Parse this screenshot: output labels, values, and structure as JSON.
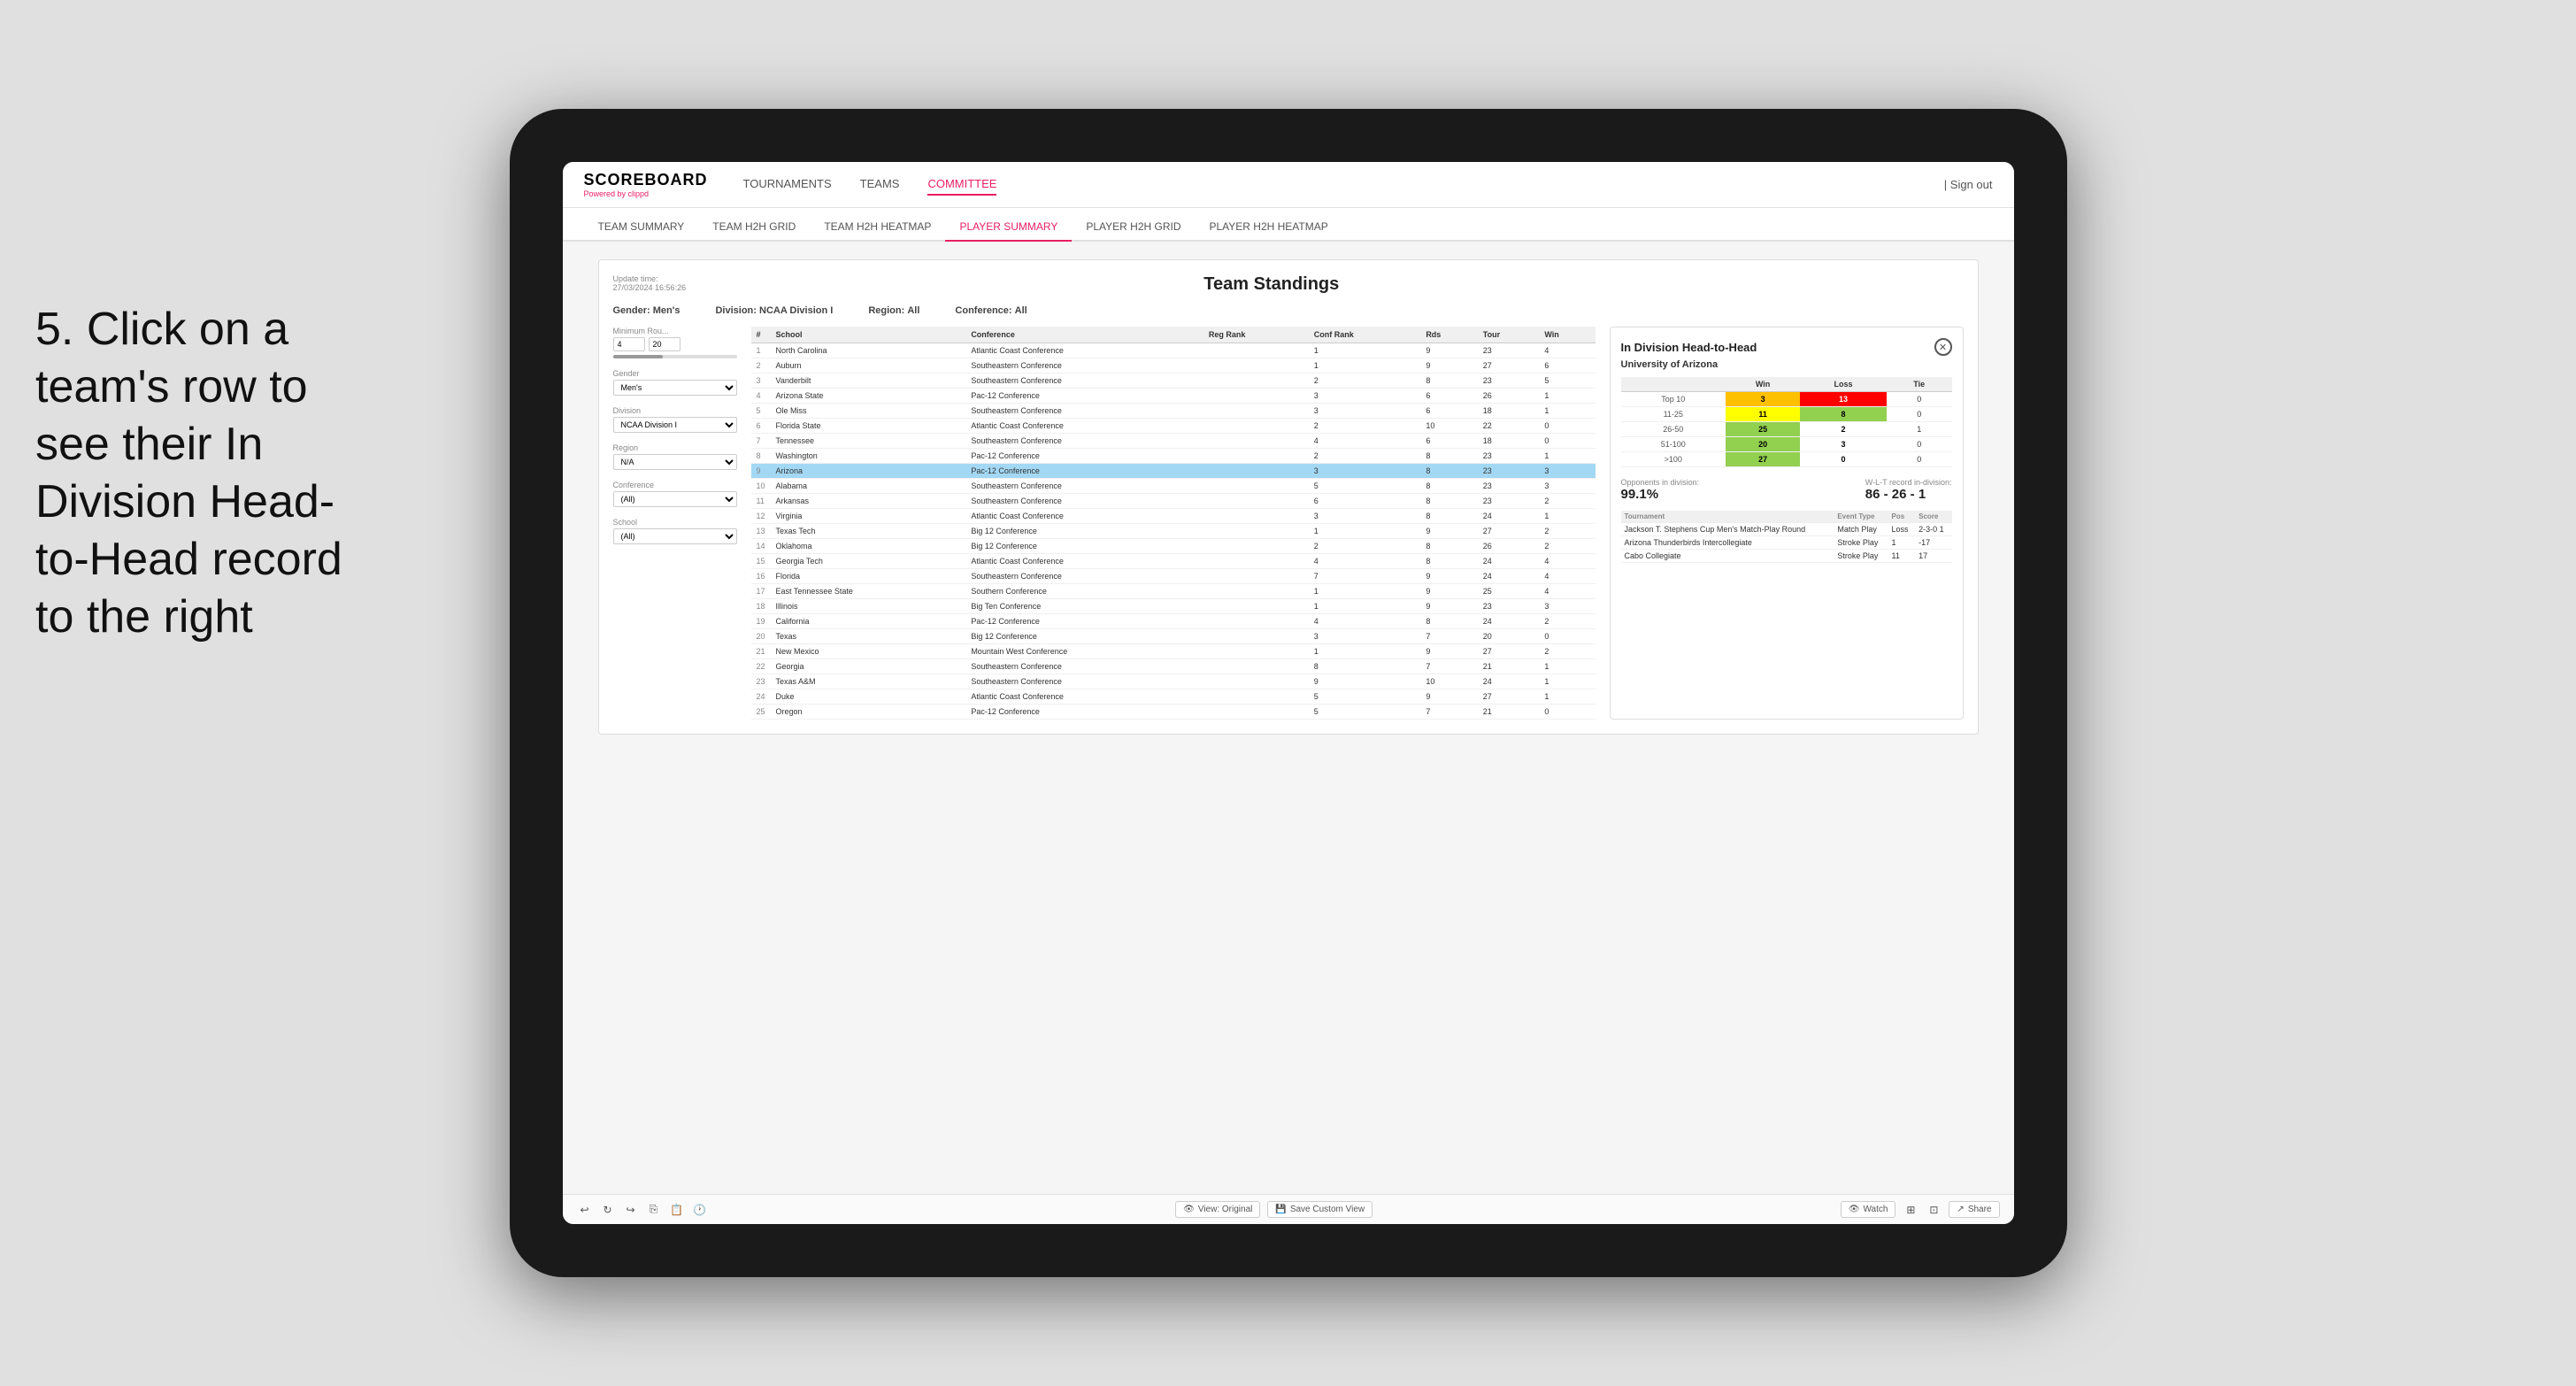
{
  "annotation": {
    "text": "5. Click on a team's row to see their In Division Head-to-Head record to the right"
  },
  "nav": {
    "logo": "SCOREBOARD",
    "logo_sub": "Powered by",
    "logo_brand": "clippd",
    "items": [
      "TOURNAMENTS",
      "TEAMS",
      "COMMITTEE"
    ],
    "active_item": "COMMITTEE",
    "sign_out": "Sign out"
  },
  "sub_nav": {
    "items": [
      "TEAM SUMMARY",
      "TEAM H2H GRID",
      "TEAM H2H HEATMAP",
      "PLAYER SUMMARY",
      "PLAYER H2H GRID",
      "PLAYER H2H HEATMAP"
    ],
    "active_item": "PLAYER SUMMARY"
  },
  "card": {
    "update_time_label": "Update time:",
    "update_time_value": "27/03/2024 16:56:26",
    "title": "Team Standings",
    "filters": {
      "gender_label": "Gender:",
      "gender_value": "Men's",
      "division_label": "Division:",
      "division_value": "NCAA Division I",
      "region_label": "Region:",
      "region_value": "All",
      "conference_label": "Conference:",
      "conference_value": "All"
    }
  },
  "left_filters": {
    "min_rounds_label": "Minimum Rou...",
    "min_rounds_from": "4",
    "min_rounds_to": "20",
    "gender_label": "Gender",
    "gender_value": "Men's",
    "division_label": "Division",
    "division_value": "NCAA Division I",
    "region_label": "Region",
    "region_value": "N/A",
    "conference_label": "Conference",
    "conference_value": "(All)",
    "school_label": "School",
    "school_value": "(All)"
  },
  "table": {
    "headers": [
      "#",
      "School",
      "Conference",
      "Reg Rank",
      "Conf Rank",
      "Rds",
      "Tour",
      "Win"
    ],
    "rows": [
      {
        "num": 1,
        "school": "North Carolina",
        "conference": "Atlantic Coast Conference",
        "reg_rank": "",
        "conf_rank": 1,
        "rds": 9,
        "tour": 23,
        "win": 4
      },
      {
        "num": 2,
        "school": "Auburn",
        "conference": "Southeastern Conference",
        "reg_rank": "",
        "conf_rank": 1,
        "rds": 9,
        "tour": 27,
        "win": 6
      },
      {
        "num": 3,
        "school": "Vanderbilt",
        "conference": "Southeastern Conference",
        "reg_rank": "",
        "conf_rank": 2,
        "rds": 8,
        "tour": 23,
        "win": 5
      },
      {
        "num": 4,
        "school": "Arizona State",
        "conference": "Pac-12 Conference",
        "reg_rank": "",
        "conf_rank": 3,
        "rds": 6,
        "tour": 26,
        "win": 1
      },
      {
        "num": 5,
        "school": "Ole Miss",
        "conference": "Southeastern Conference",
        "reg_rank": "",
        "conf_rank": 3,
        "rds": 6,
        "tour": 18,
        "win": 1
      },
      {
        "num": 6,
        "school": "Florida State",
        "conference": "Atlantic Coast Conference",
        "reg_rank": "",
        "conf_rank": 2,
        "rds": 10,
        "tour": 22,
        "win": 0
      },
      {
        "num": 7,
        "school": "Tennessee",
        "conference": "Southeastern Conference",
        "reg_rank": "",
        "conf_rank": 4,
        "rds": 6,
        "tour": 18,
        "win": 0
      },
      {
        "num": 8,
        "school": "Washington",
        "conference": "Pac-12 Conference",
        "reg_rank": "",
        "conf_rank": 2,
        "rds": 8,
        "tour": 23,
        "win": 1
      },
      {
        "num": 9,
        "school": "Arizona",
        "conference": "Pac-12 Conference",
        "reg_rank": "",
        "conf_rank": 3,
        "rds": 8,
        "tour": 23,
        "win": 3,
        "highlighted": true
      },
      {
        "num": 10,
        "school": "Alabama",
        "conference": "Southeastern Conference",
        "reg_rank": "",
        "conf_rank": 5,
        "rds": 8,
        "tour": 23,
        "win": 3
      },
      {
        "num": 11,
        "school": "Arkansas",
        "conference": "Southeastern Conference",
        "reg_rank": "",
        "conf_rank": 6,
        "rds": 8,
        "tour": 23,
        "win": 2
      },
      {
        "num": 12,
        "school": "Virginia",
        "conference": "Atlantic Coast Conference",
        "reg_rank": "",
        "conf_rank": 3,
        "rds": 8,
        "tour": 24,
        "win": 1
      },
      {
        "num": 13,
        "school": "Texas Tech",
        "conference": "Big 12 Conference",
        "reg_rank": "",
        "conf_rank": 1,
        "rds": 9,
        "tour": 27,
        "win": 2
      },
      {
        "num": 14,
        "school": "Oklahoma",
        "conference": "Big 12 Conference",
        "reg_rank": "",
        "conf_rank": 2,
        "rds": 8,
        "tour": 26,
        "win": 2
      },
      {
        "num": 15,
        "school": "Georgia Tech",
        "conference": "Atlantic Coast Conference",
        "reg_rank": "",
        "conf_rank": 4,
        "rds": 8,
        "tour": 24,
        "win": 4
      },
      {
        "num": 16,
        "school": "Florida",
        "conference": "Southeastern Conference",
        "reg_rank": "",
        "conf_rank": 7,
        "rds": 9,
        "tour": 24,
        "win": 4
      },
      {
        "num": 17,
        "school": "East Tennessee State",
        "conference": "Southern Conference",
        "reg_rank": "",
        "conf_rank": 1,
        "rds": 9,
        "tour": 25,
        "win": 4
      },
      {
        "num": 18,
        "school": "Illinois",
        "conference": "Big Ten Conference",
        "reg_rank": "",
        "conf_rank": 1,
        "rds": 9,
        "tour": 23,
        "win": 3
      },
      {
        "num": 19,
        "school": "California",
        "conference": "Pac-12 Conference",
        "reg_rank": "",
        "conf_rank": 4,
        "rds": 8,
        "tour": 24,
        "win": 2
      },
      {
        "num": 20,
        "school": "Texas",
        "conference": "Big 12 Conference",
        "reg_rank": "",
        "conf_rank": 3,
        "rds": 7,
        "tour": 20,
        "win": 0
      },
      {
        "num": 21,
        "school": "New Mexico",
        "conference": "Mountain West Conference",
        "reg_rank": "",
        "conf_rank": 1,
        "rds": 9,
        "tour": 27,
        "win": 2
      },
      {
        "num": 22,
        "school": "Georgia",
        "conference": "Southeastern Conference",
        "reg_rank": "",
        "conf_rank": 8,
        "rds": 7,
        "tour": 21,
        "win": 1
      },
      {
        "num": 23,
        "school": "Texas A&M",
        "conference": "Southeastern Conference",
        "reg_rank": "",
        "conf_rank": 9,
        "rds": 10,
        "tour": 24,
        "win": 1
      },
      {
        "num": 24,
        "school": "Duke",
        "conference": "Atlantic Coast Conference",
        "reg_rank": "",
        "conf_rank": 5,
        "rds": 9,
        "tour": 27,
        "win": 1
      },
      {
        "num": 25,
        "school": "Oregon",
        "conference": "Pac-12 Conference",
        "reg_rank": "",
        "conf_rank": 5,
        "rds": 7,
        "tour": 21,
        "win": 0
      }
    ]
  },
  "h2h": {
    "title": "In Division Head-to-Head",
    "team": "University of Arizona",
    "win_label": "Win",
    "loss_label": "Loss",
    "tie_label": "Tie",
    "rows": [
      {
        "rank": "Top 10",
        "win": 3,
        "loss": 13,
        "tie": 0,
        "win_color": "orange",
        "loss_color": "red"
      },
      {
        "rank": "11-25",
        "win": 11,
        "loss": 8,
        "tie": 0,
        "win_color": "yellow",
        "loss_color": "green"
      },
      {
        "rank": "26-50",
        "win": 25,
        "loss": 2,
        "tie": 1,
        "win_color": "green",
        "loss_color": "white"
      },
      {
        "rank": "51-100",
        "win": 20,
        "loss": 3,
        "tie": 0,
        "win_color": "green",
        "loss_color": "white"
      },
      {
        "rank": ">100",
        "win": 27,
        "loss": 0,
        "tie": 0,
        "win_color": "green",
        "loss_color": "white"
      }
    ],
    "opponents_label": "Opponents in division:",
    "opponents_value": "99.1%",
    "wlt_label": "W-L-T record in-division:",
    "wlt_value": "86 - 26 - 1",
    "tournaments_title": "Tournament",
    "event_type_col": "Event Type",
    "pos_col": "Pos",
    "score_col": "Score",
    "tournaments": [
      {
        "name": "Jackson T. Stephens Cup Men's Match-Play Round",
        "event_type": "Match Play",
        "pos": "Loss",
        "score": "2-3-0 1"
      },
      {
        "name": "Arizona Thunderbirds Intercollegiate",
        "event_type": "Stroke Play",
        "pos": "1",
        "score": "-17"
      },
      {
        "name": "Cabo Collegiate",
        "event_type": "Stroke Play",
        "pos": "11",
        "score": "17"
      }
    ]
  },
  "toolbar": {
    "undo": "↩",
    "redo": "↪",
    "view_original": "View: Original",
    "save_custom": "Save Custom View",
    "watch": "Watch",
    "share": "Share"
  }
}
